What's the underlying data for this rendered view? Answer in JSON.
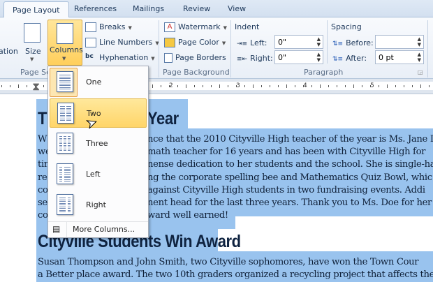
{
  "tabs": [
    "Page Layout",
    "References",
    "Mailings",
    "Review",
    "View"
  ],
  "active_tab": "Page Layout",
  "ribbon": {
    "page_setup": {
      "label": "Page Se",
      "orientation": "ation",
      "size": "Size",
      "columns": "Columns",
      "breaks": "Breaks",
      "line_numbers": "Line Numbers",
      "hyphenation": "Hyphenation"
    },
    "page_background": {
      "label": "Page Background",
      "watermark": "Watermark",
      "page_color": "Page Color",
      "page_borders": "Page Borders"
    },
    "paragraph": {
      "label": "Paragraph",
      "indent_title": "Indent",
      "left_label": "Left:",
      "left_value": "0\"",
      "right_label": "Right:",
      "right_value": "0\"",
      "spacing_title": "Spacing",
      "before_label": "Before:",
      "before_value": "",
      "after_label": "After:",
      "after_value": "0 pt"
    }
  },
  "ruler": {
    "numbers": [
      "2",
      "3",
      "4",
      "5"
    ]
  },
  "columns_menu": {
    "items": [
      {
        "label": "One",
        "checked": true
      },
      {
        "label": "Two",
        "hover": true
      },
      {
        "label": "Three"
      },
      {
        "label": "Left"
      },
      {
        "label": "Right"
      }
    ],
    "more": "More Columns..."
  },
  "document": {
    "heading1_left": "T",
    "heading1_right": "Year",
    "para1": [
      {
        "left": "W",
        "right": "nce that the 2010 Cityville High teacher of the year is Ms. Jane D"
      },
      {
        "left": "we",
        "right": " math teacher for 16 years and has been with Cityville High for"
      },
      {
        "left": "tin",
        "right": "nense dedication to her students and the school. She is single-ha"
      },
      {
        "left": "res",
        "right": "ng the corporate spelling bee and Mathematics Quiz Bowl, whic"
      },
      {
        "left": "co",
        "right": "against Cityville High students in two fundraising events. Addi"
      },
      {
        "left": "ser",
        "right": "nent head for the last three years. Thank you to Ms. Doe for her"
      },
      {
        "left": "co",
        "right": "ward well earned!"
      }
    ],
    "heading2": "Cityville Students Win Award",
    "para2": [
      "Susan Thompson and John Smith, two Cityville sophomores, have won the Town Cour",
      "a Better place award. The two 10th graders organized a recycling project that affects the"
    ]
  },
  "colors": {
    "selection": "#99c3ee",
    "hover": "#ffd569",
    "accent": "#1e395b"
  }
}
